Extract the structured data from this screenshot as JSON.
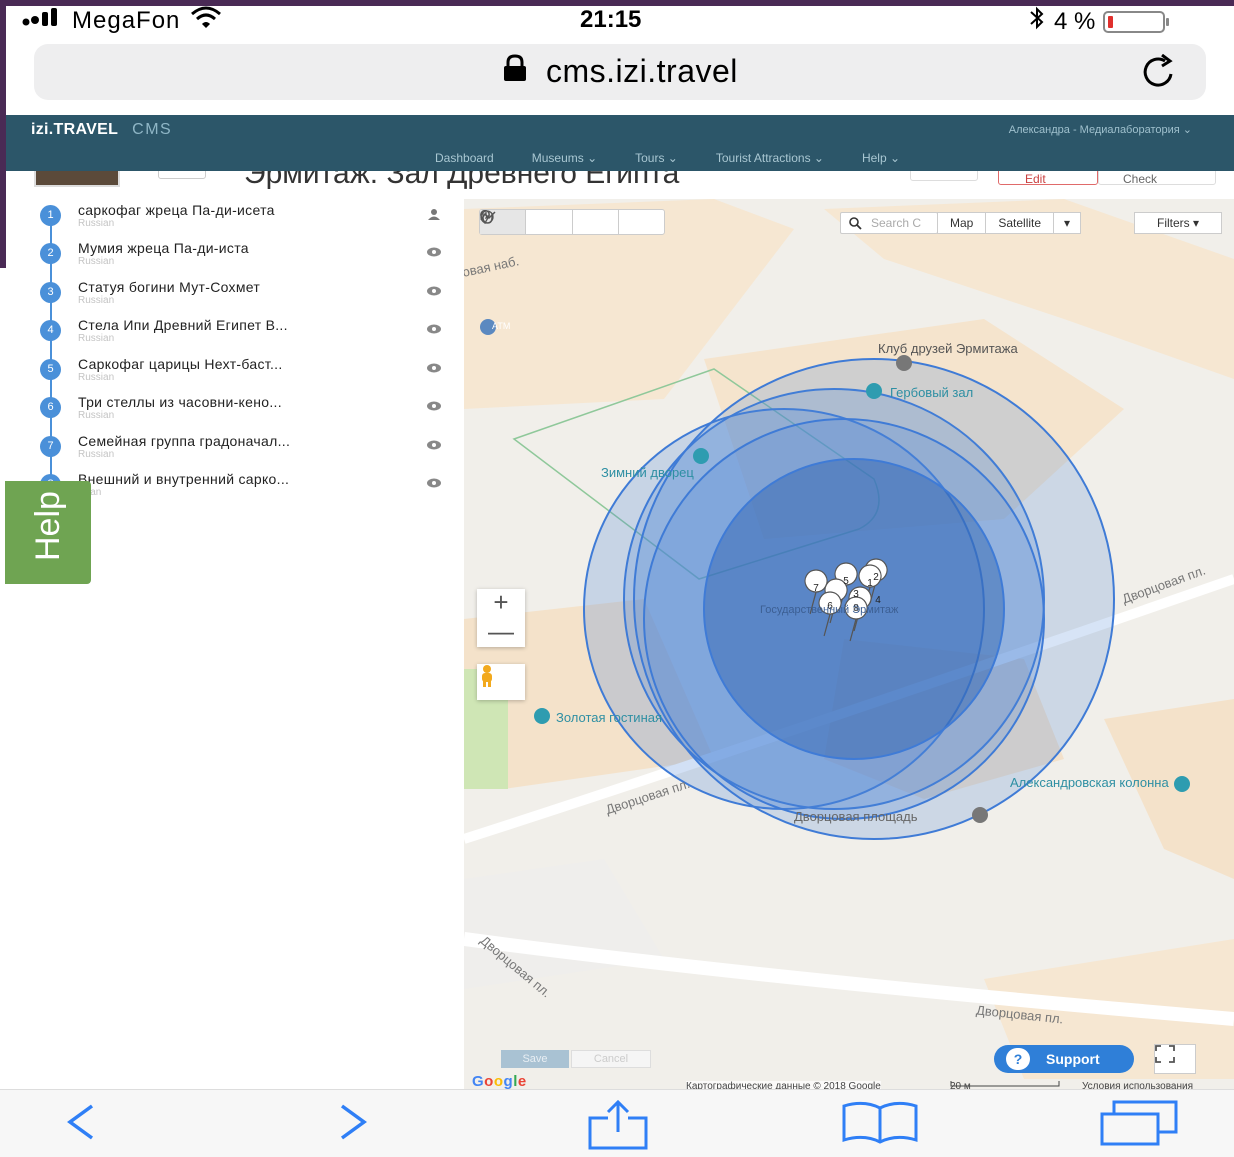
{
  "status_bar": {
    "carrier": "MegaFon",
    "time": "21:15",
    "battery": "4 %"
  },
  "browser": {
    "url": "cms.izi.travel"
  },
  "cms": {
    "logo": "izi.TRAVEL",
    "logo_suffix": "CMS",
    "user": "Александра - Медиалаборатория ⌄",
    "nav": [
      "Dashboard",
      "Museums ⌄",
      "Tours ⌄",
      "Tourist Attractions ⌄",
      "Help ⌄"
    ],
    "page_title": "Эрмитаж. Зал Древнего Египта",
    "edit_label": "Edit",
    "check_label": "Check"
  },
  "exhibits": [
    {
      "num": "1",
      "name": "саркофаг жреца Па-ди-исета",
      "lang": "Russian",
      "icon": "user-icon"
    },
    {
      "num": "2",
      "name": "Мумия жреца Па-ди-иста",
      "lang": "Russian",
      "icon": "eye-icon"
    },
    {
      "num": "3",
      "name": "Статуя богини Мут-Сохмет",
      "lang": "Russian",
      "icon": "eye-icon"
    },
    {
      "num": "4",
      "name": "Стела Ипи Древний Египет В...",
      "lang": "Russian",
      "icon": "eye-icon"
    },
    {
      "num": "5",
      "name": "Саркофаг царицы Нехт-баст...",
      "lang": "Russian",
      "icon": "eye-icon"
    },
    {
      "num": "6",
      "name": "Три стеллы из часовни-кено...",
      "lang": "Russian",
      "icon": "eye-icon"
    },
    {
      "num": "7",
      "name": "Семейная группа градоначал...",
      "lang": "Russian",
      "icon": "eye-icon"
    },
    {
      "num": "8",
      "name": "Внешний и внутренний сарко...",
      "lang": "ssian",
      "icon": "eye-icon"
    }
  ],
  "help_tab": "Help",
  "map": {
    "search_placeholder": "Search C",
    "map_type": "Map",
    "satellite": "Satellite",
    "filters": "Filters ▾",
    "zoom_in": "+",
    "zoom_out": "—",
    "labels": {
      "club": "Клуб друзей Эрмитажа",
      "herb_hall": "Гербовый зал",
      "winter_palace": "Зимний дворец",
      "golden_room": "Золотая гостиная",
      "alexander_column": "Александровская колонна",
      "palace_square": "Дворцовая площадь",
      "hermitage_partial": "Государственный Эрмитаж",
      "emb": "овая наб.",
      "palace_pass": "Дворцовая пл.",
      "atm": "ATM"
    },
    "save": "Save",
    "cancel": "Cancel",
    "support": "Support",
    "google": "Google",
    "attribution": "Картографические данные © 2018 Google",
    "scale": "20 м",
    "terms": "Условия использования"
  },
  "colors": {
    "header": "#1a485c",
    "accent": "#4a90d9",
    "help": "#6fa452",
    "support": "#2f7fd8"
  }
}
